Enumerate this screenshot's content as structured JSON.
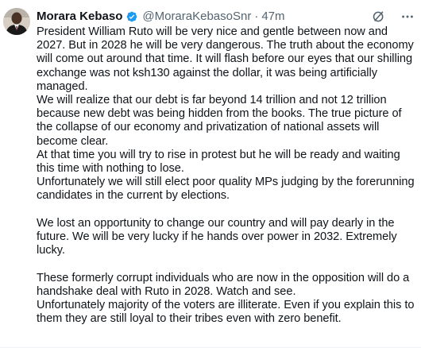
{
  "author": {
    "name": "Morara Kebaso",
    "handle": "@MoraraKebasoSnr",
    "separator": "·",
    "time": "47m"
  },
  "icons": {
    "verified": "verified-badge-icon",
    "grok": "grok-icon",
    "more": "more-icon",
    "brand_blue": "#1d9bf0"
  },
  "tweet": {
    "p1": "President William Ruto will be very nice and gentle between now and 2027. But in 2028 he will be very dangerous. The truth about the economy will come out around that time. It will flash before our eyes that our shilling exchange was not ksh130 against the dollar, it was being artificially managed.",
    "p2": "We will realize that our debt is far beyond 14 trillion and not 12 trillion because new debt was being hidden from the books. The true picture of the collapse of our economy and privatization of national assets will become clear.",
    "p3": "At that time you will try to rise in protest but he will be ready and waiting this time with nothing to lose.",
    "p4": "Unfortunately we will still elect poor quality MPs judging by the forerunning candidates in the current by elections.",
    "p5": "We lost an opportunity to change our country and will pay dearly in the future. We will be very lucky if he hands over power in 2032. Extremely lucky.",
    "p6": "These formerly corrupt individuals who are now in the opposition will do a handshake deal with Ruto in 2028. Watch and see.",
    "p7": "Unfortunately majority of the voters are illiterate. Even if you explain this to them they are still loyal to their tribes even with zero benefit."
  }
}
